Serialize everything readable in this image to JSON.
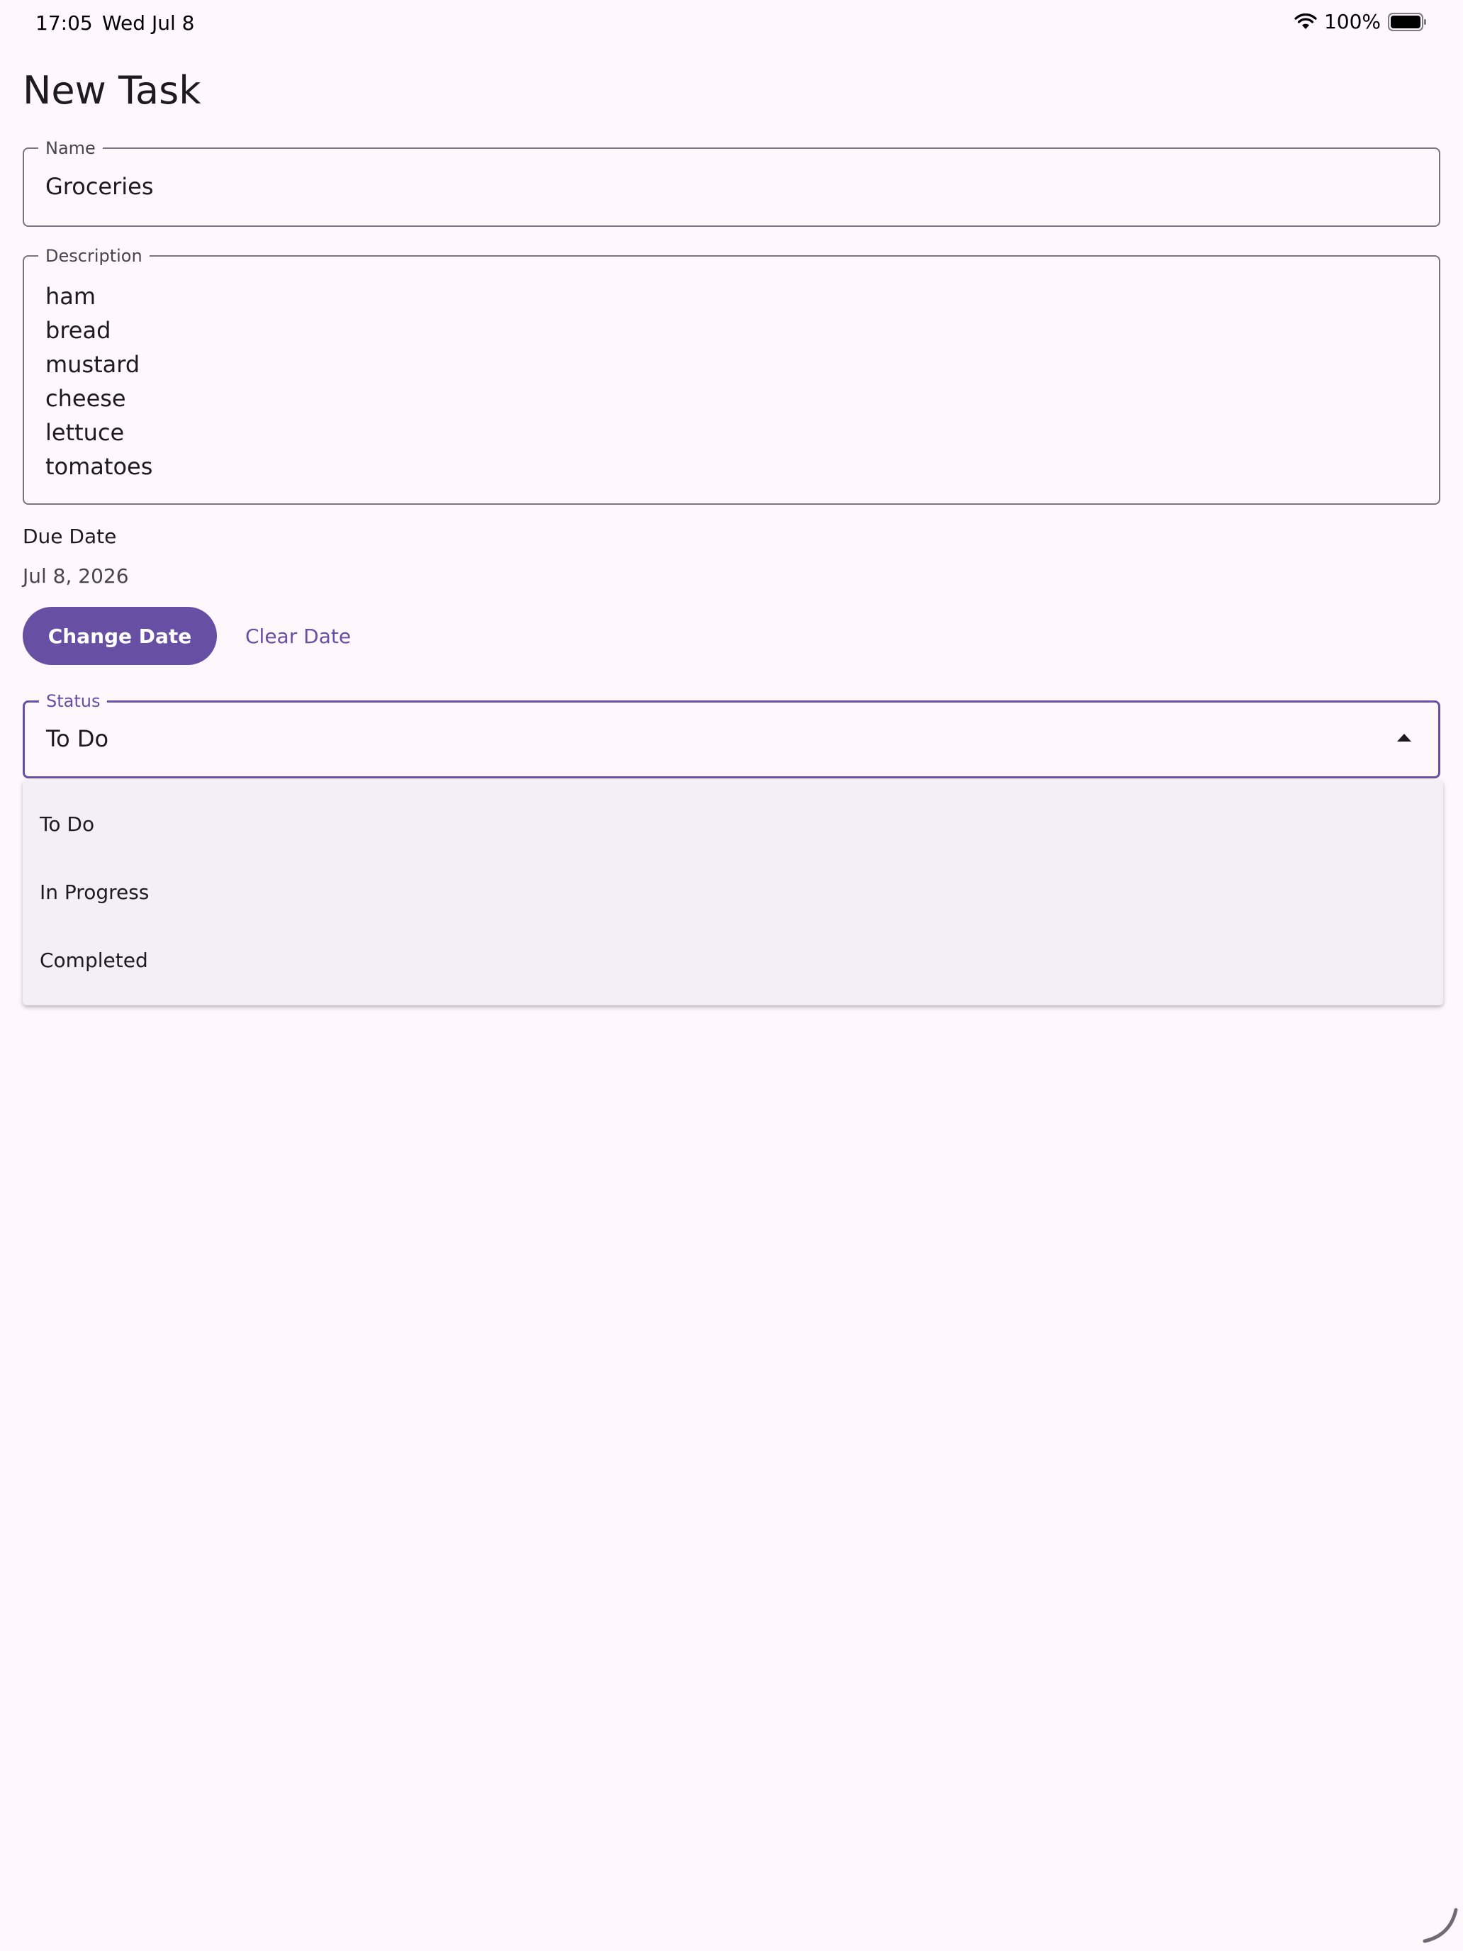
{
  "status_bar": {
    "time": "17:05",
    "date": "Wed Jul 8",
    "battery_percent": "100%",
    "icons": [
      "wifi-icon",
      "battery-icon"
    ]
  },
  "page": {
    "title": "New Task"
  },
  "form": {
    "name": {
      "label": "Name",
      "value": "Groceries"
    },
    "description": {
      "label": "Description",
      "lines": [
        "ham",
        "bread",
        "mustard",
        "cheese",
        "lettuce",
        "tomatoes"
      ]
    },
    "due_date": {
      "label": "Due Date",
      "value": "Jul 8, 2026",
      "change_label": "Change Date",
      "clear_label": "Clear Date"
    },
    "status": {
      "label": "Status",
      "value": "To Do",
      "options": [
        "To Do",
        "In Progress",
        "Completed"
      ]
    }
  },
  "colors": {
    "primary": "#6750a4",
    "background": "#fef7fc",
    "menu_surface": "#f3eff6",
    "outline": "#79747e",
    "on_surface": "#1d1b20"
  }
}
